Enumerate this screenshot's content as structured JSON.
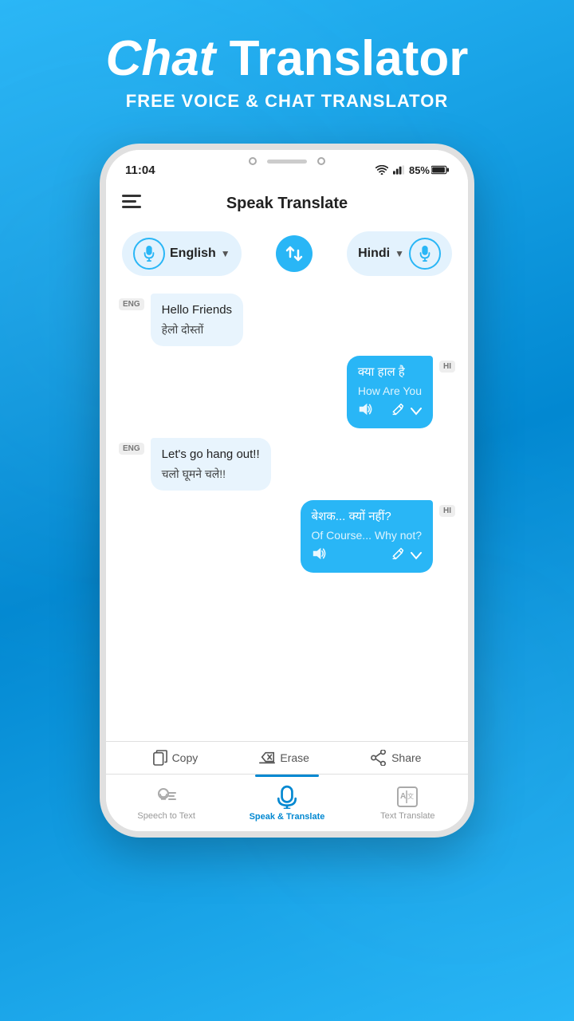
{
  "header": {
    "title_chat": "Chat",
    "title_translator": " Translator",
    "subtitle": "FREE VOICE & CHAT TRANSLATOR"
  },
  "statusBar": {
    "time": "11:04",
    "battery": "85%"
  },
  "appBar": {
    "title": "Speak Translate"
  },
  "langSelector": {
    "source_lang": "English",
    "target_lang": "Hindi"
  },
  "messages": [
    {
      "id": 1,
      "side": "left",
      "tag": "ENG",
      "original": "Hello Friends",
      "translation": "हेलो दोस्तों"
    },
    {
      "id": 2,
      "side": "right",
      "tag": "HI",
      "original": "क्या हाल है",
      "translation": "How Are You"
    },
    {
      "id": 3,
      "side": "left",
      "tag": "ENG",
      "original": "Let's go hang out!!",
      "translation": "चलो घूमने चले!!"
    },
    {
      "id": 4,
      "side": "right",
      "tag": "HI",
      "original": "बेशक... क्यों नहीं?",
      "translation": "Of Course... Why not?"
    }
  ],
  "bottomActions": [
    {
      "icon": "copy",
      "label": "Copy"
    },
    {
      "icon": "erase",
      "label": "Erase"
    },
    {
      "icon": "share",
      "label": "Share"
    }
  ],
  "bottomNav": [
    {
      "id": "speech-to-text",
      "label": "Speech to Text",
      "active": false
    },
    {
      "id": "speak-translate",
      "label": "Speak & Translate",
      "active": true
    },
    {
      "id": "text-translate",
      "label": "Text Translate",
      "active": false
    }
  ]
}
